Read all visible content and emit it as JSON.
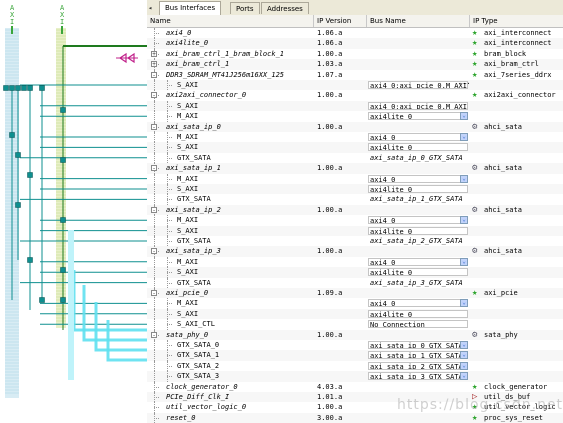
{
  "bus_panel": {
    "buses": [
      {
        "label": "AXI",
        "color": "#3aa53a"
      },
      {
        "label": "AXI",
        "color": "#3aa53a"
      }
    ]
  },
  "tabs": [
    {
      "label": "Bus Interfaces",
      "active": true
    },
    {
      "label": "Ports",
      "active": false
    },
    {
      "label": "Addresses",
      "active": false
    }
  ],
  "columns": [
    "Name",
    "IP Version",
    "Bus Name",
    "IP Type"
  ],
  "rows": [
    {
      "level": 0,
      "toggle": "",
      "name": "axi4_0",
      "version": "1.06.a",
      "bus": "",
      "bus_field": false,
      "dd": false,
      "ip_type": "axi_interconnect",
      "icon": "star"
    },
    {
      "level": 0,
      "toggle": "",
      "name": "axi4lite_0",
      "version": "1.06.a",
      "bus": "",
      "bus_field": false,
      "dd": false,
      "ip_type": "axi_interconnect",
      "icon": "star"
    },
    {
      "level": 0,
      "toggle": "+",
      "name": "axi_bram_ctrl_1_bram_block_1",
      "version": "1.00.a",
      "bus": "",
      "bus_field": false,
      "dd": false,
      "ip_type": "bram_block",
      "icon": "star"
    },
    {
      "level": 0,
      "toggle": "+",
      "name": "axi_bram_ctrl_1",
      "version": "1.03.a",
      "bus": "",
      "bus_field": false,
      "dd": false,
      "ip_type": "axi_bram_ctrl",
      "icon": "star"
    },
    {
      "level": 0,
      "toggle": "-",
      "name": "DDR3_SDRAM_MT41J256m16XX_125",
      "version": "1.07.a",
      "bus": "",
      "bus_field": false,
      "dd": false,
      "ip_type": "axi_7series_ddrx",
      "icon": "star"
    },
    {
      "level": 1,
      "toggle": "",
      "name": "S_AXI",
      "version": "",
      "bus": "axi4_0:axi_pcie_0.M_AXI",
      "bus_field": true,
      "dd": false,
      "dots": true,
      "ip_type": "",
      "icon": ""
    },
    {
      "level": 0,
      "toggle": "-",
      "name": "axi2axi_connector_0",
      "version": "1.00.a",
      "bus": "",
      "bus_field": false,
      "dd": false,
      "ip_type": "axi2axi_connector",
      "icon": "star"
    },
    {
      "level": 1,
      "toggle": "",
      "name": "S_AXI",
      "version": "",
      "bus": "axi4_0:axi_pcie_0.M_AXI",
      "bus_field": true,
      "dd": false,
      "ip_type": "",
      "icon": ""
    },
    {
      "level": 1,
      "toggle": "",
      "name": "M_AXI",
      "version": "",
      "bus": "axi4lite_0",
      "bus_field": true,
      "dd": true,
      "ip_type": "",
      "icon": ""
    },
    {
      "level": 0,
      "toggle": "-",
      "name": "axi_sata_ip_0",
      "version": "1.00.a",
      "bus": "",
      "bus_field": false,
      "dd": false,
      "ip_type": "ahci_sata",
      "icon": "gear"
    },
    {
      "level": 1,
      "toggle": "",
      "name": "M_AXI",
      "version": "",
      "bus": "axi4_0",
      "bus_field": true,
      "dd": true,
      "ip_type": "",
      "icon": ""
    },
    {
      "level": 1,
      "toggle": "",
      "name": "S_AXI",
      "version": "",
      "bus": "axi4lite_0",
      "bus_field": true,
      "dd": false,
      "ip_type": "",
      "icon": ""
    },
    {
      "level": 1,
      "toggle": "",
      "name": "GTX_SATA",
      "version": "",
      "bus": "axi_sata_ip_0_GTX_SATA",
      "bus_field": false,
      "dd": false,
      "italic_bus": true,
      "ip_type": "",
      "icon": ""
    },
    {
      "level": 0,
      "toggle": "-",
      "name": "axi_sata_ip_1",
      "version": "1.00.a",
      "bus": "",
      "bus_field": false,
      "dd": false,
      "ip_type": "ahci_sata",
      "icon": "gear"
    },
    {
      "level": 1,
      "toggle": "",
      "name": "M_AXI",
      "version": "",
      "bus": "axi4_0",
      "bus_field": true,
      "dd": true,
      "ip_type": "",
      "icon": ""
    },
    {
      "level": 1,
      "toggle": "",
      "name": "S_AXI",
      "version": "",
      "bus": "axi4lite_0",
      "bus_field": true,
      "dd": false,
      "ip_type": "",
      "icon": ""
    },
    {
      "level": 1,
      "toggle": "",
      "name": "GTX_SATA",
      "version": "",
      "bus": "axi_sata_ip_1_GTX_SATA",
      "bus_field": false,
      "dd": false,
      "italic_bus": true,
      "ip_type": "",
      "icon": ""
    },
    {
      "level": 0,
      "toggle": "-",
      "name": "axi_sata_ip_2",
      "version": "1.00.a",
      "bus": "",
      "bus_field": false,
      "dd": false,
      "ip_type": "ahci_sata",
      "icon": "gear"
    },
    {
      "level": 1,
      "toggle": "",
      "name": "M_AXI",
      "version": "",
      "bus": "axi4_0",
      "bus_field": true,
      "dd": true,
      "ip_type": "",
      "icon": ""
    },
    {
      "level": 1,
      "toggle": "",
      "name": "S_AXI",
      "version": "",
      "bus": "axi4lite_0",
      "bus_field": true,
      "dd": false,
      "ip_type": "",
      "icon": ""
    },
    {
      "level": 1,
      "toggle": "",
      "name": "GTX_SATA",
      "version": "",
      "bus": "axi_sata_ip_2_GTX_SATA",
      "bus_field": false,
      "dd": false,
      "italic_bus": true,
      "ip_type": "",
      "icon": ""
    },
    {
      "level": 0,
      "toggle": "-",
      "name": "axi_sata_ip_3",
      "version": "1.00.a",
      "bus": "",
      "bus_field": false,
      "dd": false,
      "ip_type": "ahci_sata",
      "icon": "gear"
    },
    {
      "level": 1,
      "toggle": "",
      "name": "M_AXI",
      "version": "",
      "bus": "axi4_0",
      "bus_field": true,
      "dd": true,
      "ip_type": "",
      "icon": ""
    },
    {
      "level": 1,
      "toggle": "",
      "name": "S_AXI",
      "version": "",
      "bus": "axi4lite_0",
      "bus_field": true,
      "dd": false,
      "ip_type": "",
      "icon": ""
    },
    {
      "level": 1,
      "toggle": "",
      "name": "GTX_SATA",
      "version": "",
      "bus": "axi_sata_ip_3_GTX_SATA",
      "bus_field": false,
      "dd": false,
      "italic_bus": true,
      "ip_type": "",
      "icon": ""
    },
    {
      "level": 0,
      "toggle": "-",
      "name": "axi_pcie_0",
      "version": "1.09.a",
      "bus": "",
      "bus_field": false,
      "dd": false,
      "ip_type": "axi_pcie",
      "icon": "star"
    },
    {
      "level": 1,
      "toggle": "",
      "name": "M_AXI",
      "version": "",
      "bus": "axi4_0",
      "bus_field": true,
      "dd": true,
      "ip_type": "",
      "icon": ""
    },
    {
      "level": 1,
      "toggle": "",
      "name": "S_AXI",
      "version": "",
      "bus": "axi4lite_0",
      "bus_field": true,
      "dd": false,
      "ip_type": "",
      "icon": ""
    },
    {
      "level": 1,
      "toggle": "",
      "name": "S_AXI_CTL",
      "version": "",
      "bus": "No Connection",
      "bus_field": true,
      "dd": false,
      "ip_type": "",
      "icon": ""
    },
    {
      "level": 0,
      "toggle": "-",
      "name": "sata_phy_0",
      "version": "1.00.a",
      "bus": "",
      "bus_field": false,
      "dd": false,
      "ip_type": "sata_phy",
      "icon": "gear"
    },
    {
      "level": 1,
      "toggle": "",
      "name": "GTX_SATA_0",
      "version": "",
      "bus": "axi_sata_ip_0_GTX_SATA",
      "bus_field": true,
      "dd": true,
      "ip_type": "",
      "icon": ""
    },
    {
      "level": 1,
      "toggle": "",
      "name": "GTX_SATA_1",
      "version": "",
      "bus": "axi_sata_ip_1_GTX_SATA",
      "bus_field": true,
      "dd": true,
      "ip_type": "",
      "icon": ""
    },
    {
      "level": 1,
      "toggle": "",
      "name": "GTX_SATA_2",
      "version": "",
      "bus": "axi_sata_ip_2_GTX_SATA",
      "bus_field": true,
      "dd": true,
      "ip_type": "",
      "icon": ""
    },
    {
      "level": 1,
      "toggle": "",
      "name": "GTX_SATA_3",
      "version": "",
      "bus": "axi_sata_ip_3_GTX_SATA",
      "bus_field": true,
      "dd": true,
      "ip_type": "",
      "icon": ""
    },
    {
      "level": 0,
      "toggle": "",
      "name": "clock_generator_0",
      "version": "4.03.a",
      "bus": "",
      "bus_field": false,
      "dd": false,
      "ip_type": "clock_generator",
      "icon": "star"
    },
    {
      "level": 0,
      "toggle": "",
      "name": "PCIe_Diff_Clk_I",
      "version": "1.01.a",
      "bus": "",
      "bus_field": false,
      "dd": false,
      "ip_type": "util_ds_buf",
      "icon": "inv"
    },
    {
      "level": 0,
      "toggle": "",
      "name": "util_vector_logic_0",
      "version": "1.00.a",
      "bus": "",
      "bus_field": false,
      "dd": false,
      "ip_type": "util_vector_logic",
      "icon": "star"
    },
    {
      "level": 0,
      "toggle": "",
      "name": "reset_0",
      "version": "3.00.a",
      "bus": "",
      "bus_field": false,
      "dd": false,
      "ip_type": "proc_sys_reset",
      "icon": "star"
    }
  ],
  "watermark": "https://blog.csdn.net/"
}
